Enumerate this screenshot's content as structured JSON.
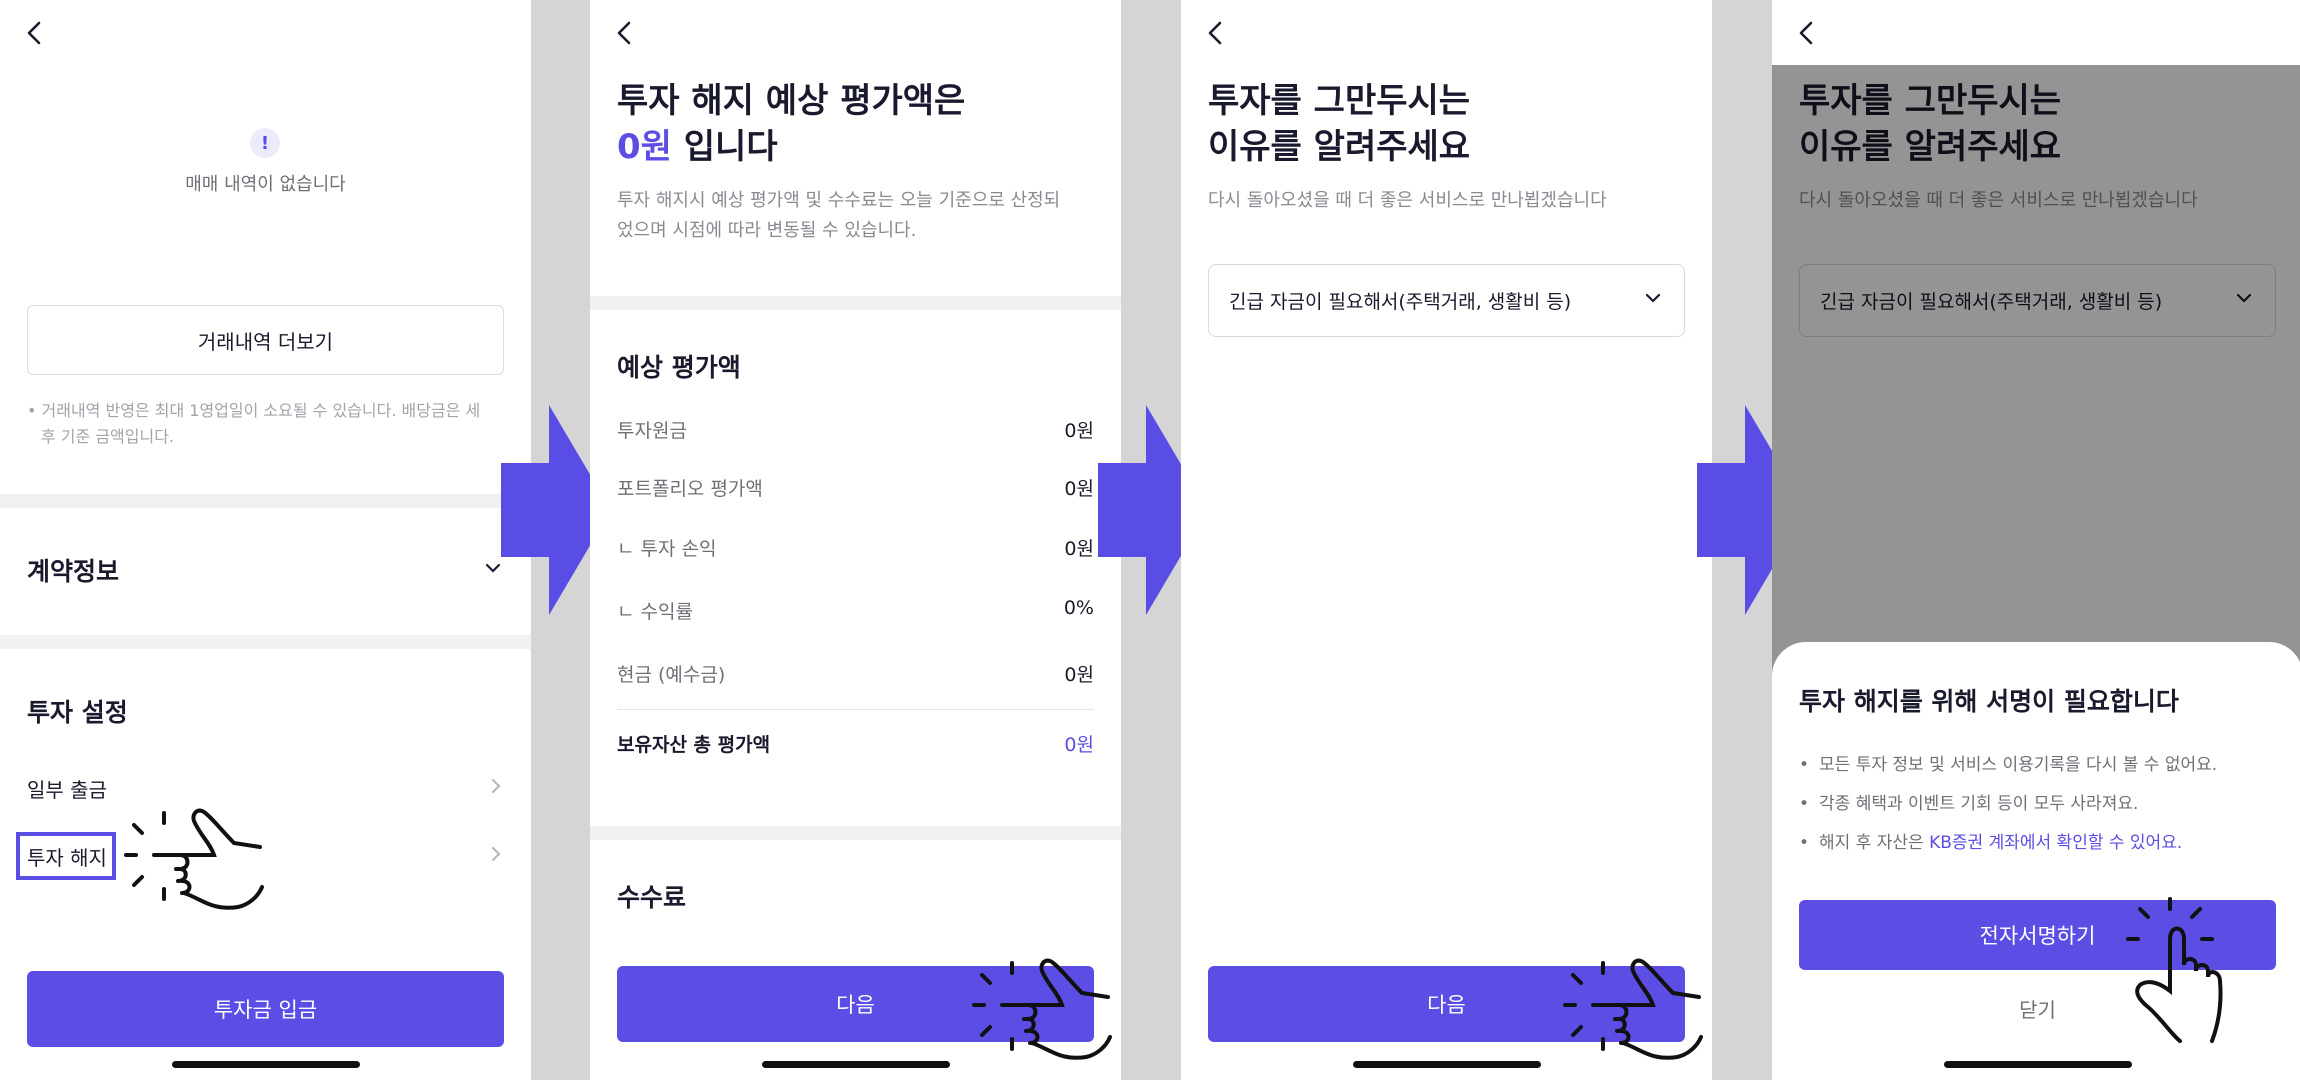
{
  "screen1": {
    "empty_text": "매매 내역이 없습니다",
    "more_button": "거래내역 더보기",
    "note_line1": "• 거래내역 반영은 최대 1영업일이 소요될 수 있습니다. 배당금은 세",
    "note_line2": "후 기준 금액입니다.",
    "contract_title": "계약정보",
    "settings_title": "투자 설정",
    "item_partial": "일부 출금",
    "item_cancel": "투자 해지",
    "deposit_button": "투자금 입금"
  },
  "screen2": {
    "title_line1": "투자 해지 예상 평가액은",
    "title_amount": "0원",
    "title_suffix": " 입니다",
    "sub_line1": "투자 해지시 예상 평가액 및 수수료는 오늘 기준으로 산정되",
    "sub_line2": "었으며 시점에 따라 변동될 수 있습니다.",
    "section_title": "예상 평가액",
    "rows": [
      {
        "label": "투자원금",
        "value": "0원"
      },
      {
        "label": "포트폴리오 평가액",
        "value": "0원"
      },
      {
        "label": "ㄴ  투자 손익",
        "value": "0원"
      },
      {
        "label": "ㄴ  수익률",
        "value": "0%"
      },
      {
        "label": "현금 (예수금)",
        "value": "0원"
      }
    ],
    "total_label": "보유자산 총 평가액",
    "total_value": "0원",
    "fee_title": "수수료",
    "next_button": "다음"
  },
  "screen3": {
    "title_line1": "투자를 그만두시는",
    "title_line2": "이유를 알려주세요",
    "sub": "다시 돌아오셨을 때 더 좋은 서비스로 만나뵙겠습니다",
    "select_value": "긴급 자금이 필요해서(주택거래, 생활비 등)",
    "next_button": "다음"
  },
  "screen4": {
    "title_line1": "투자를 그만두시는",
    "title_line2": "이유를 알려주세요",
    "sub": "다시 돌아오셨을 때 더 좋은 서비스로 만나뵙겠습니다",
    "select_value": "긴급 자금이 필요해서(주택거래, 생활비 등)",
    "sheet_title": "투자 해지를 위해 서명이 필요합니다",
    "bullet1": "모든 투자 정보 및 서비스 이용기록을 다시 볼 수 없어요.",
    "bullet2": "각종 혜택과 이벤트 기회 등이 모두 사라져요.",
    "bullet3_prefix": "해지 후 자산은 ",
    "bullet3_link": "KB증권 계좌에서 확인할 수 있어요.",
    "sign_button": "전자서명하기",
    "close_button": "닫기"
  },
  "colors": {
    "accent": "#5c4ee5",
    "arrow": "#5a4de6"
  }
}
